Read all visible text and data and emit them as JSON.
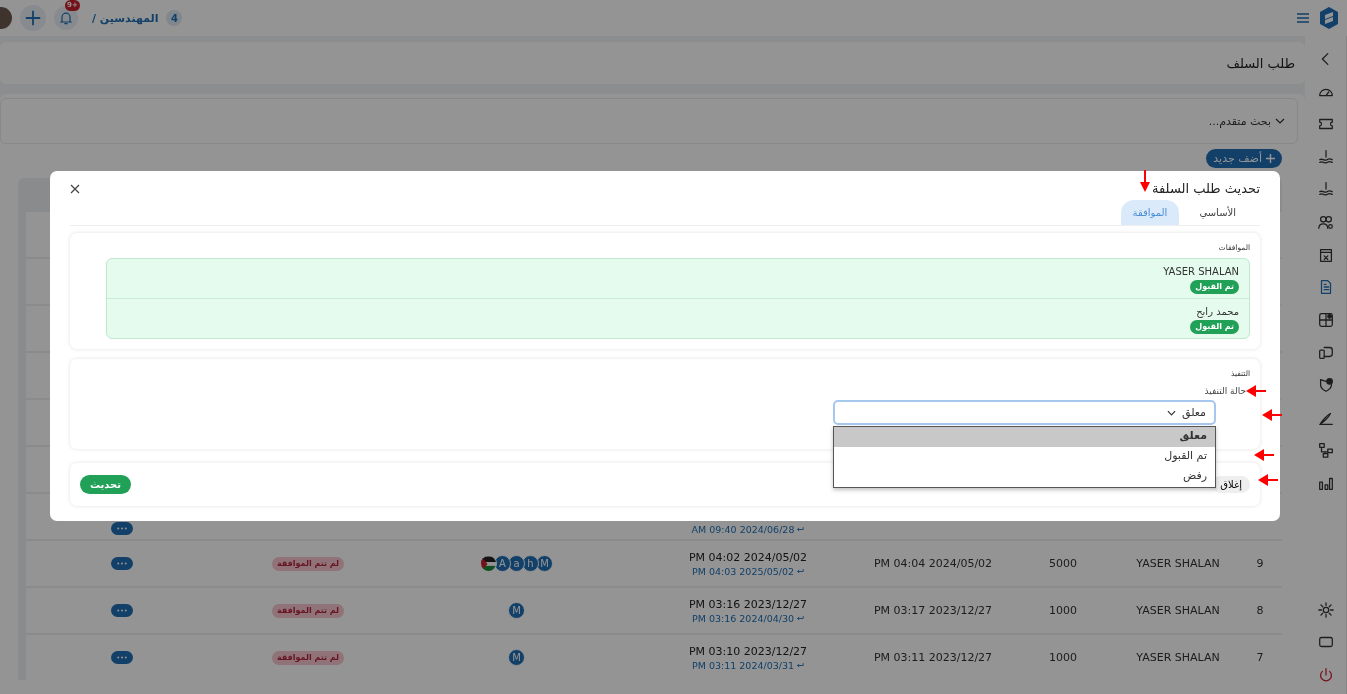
{
  "topbar": {
    "breadcrumb": "المهندسين /",
    "count": "4",
    "notification_badge": "+9"
  },
  "sidebar": {
    "items": [
      {
        "selected": false
      },
      {
        "selected": false
      },
      {
        "selected": false
      },
      {
        "selected": false
      },
      {
        "selected": false
      },
      {
        "selected": false
      },
      {
        "selected": true
      },
      {
        "selected": false
      },
      {
        "selected": false
      },
      {
        "selected": false
      },
      {
        "selected": false
      },
      {
        "selected": false
      },
      {
        "selected": false
      }
    ]
  },
  "page": {
    "title": "طلب السلف",
    "advanced_search": "بحث متقدم...",
    "add_button": "أضف جديد"
  },
  "table": {
    "rows": [
      {
        "sub_time": "AM 09:40 2024/06/28"
      },
      {
        "index": "9",
        "name": "YASER SHALAN",
        "amount": "5000",
        "date": "PM 04:04 2024/05/02",
        "time": "PM 04:02 2024/05/02",
        "sub_time": "PM 04:03 2025/05/02",
        "avatars": [
          {
            "kind": "letter",
            "text": "M"
          },
          {
            "kind": "letter",
            "text": "h"
          },
          {
            "kind": "letter",
            "text": "a"
          },
          {
            "kind": "letter",
            "text": "A"
          },
          {
            "kind": "image"
          }
        ],
        "status": {
          "kind": "pending",
          "text": "لم تتم الموافقة"
        }
      },
      {
        "index": "8",
        "name": "YASER SHALAN",
        "amount": "1000",
        "date": "PM 03:17 2023/12/27",
        "time": "PM 03:16 2023/12/27",
        "sub_time": "PM 03:16 2024/04/30",
        "avatars": [
          {
            "kind": "letter",
            "text": "M"
          }
        ],
        "status": {
          "kind": "pending",
          "text": "لم تتم الموافقة"
        }
      },
      {
        "index": "7",
        "name": "YASER SHALAN",
        "amount": "1000",
        "date": "PM 03:11 2023/12/27",
        "time": "PM 03:10 2023/12/27",
        "sub_time": "PM 03:11 2024/03/31",
        "avatars": [
          {
            "kind": "letter",
            "text": "M"
          }
        ],
        "status": {
          "kind": "pending",
          "text": "لم تتم الموافقة"
        }
      }
    ]
  },
  "modal": {
    "title": "تحديث طلب السلفة",
    "tabs": [
      {
        "label": "الأساسي",
        "selected": false
      },
      {
        "label": "الموافقة",
        "selected": true
      }
    ],
    "approvals": {
      "label": "الموافقات",
      "items": [
        {
          "name": "YASER SHALAN",
          "status": {
            "kind": "accepted",
            "text": "تم القبول"
          }
        },
        {
          "name": "محمد رابح",
          "status": {
            "kind": "accepted",
            "text": "تم القبول"
          }
        }
      ]
    },
    "execution": {
      "label": "التنفيذ",
      "field_label": "حالة التنفيذ",
      "value": "معلق",
      "expanded": true,
      "options": [
        {
          "label": "معلق",
          "selected": true
        },
        {
          "label": "تم القبول",
          "selected": false
        },
        {
          "label": "رفض",
          "selected": false
        }
      ]
    },
    "buttons": {
      "update": "تحديث",
      "close": "إغلاق"
    }
  }
}
